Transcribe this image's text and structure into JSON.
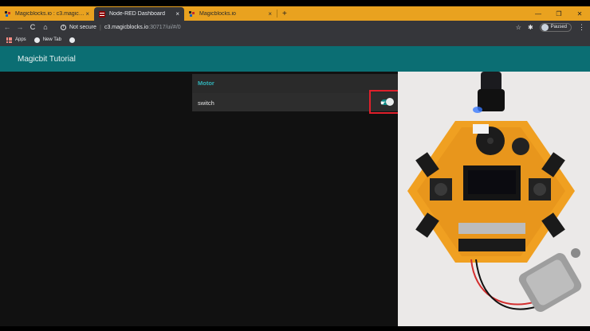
{
  "tabs": [
    {
      "label": "Magicblocks.io : c3.magicblocks...",
      "active": false,
      "favicon": "magicblocks-favicon"
    },
    {
      "label": "Node-RED Dashboard",
      "active": true,
      "favicon": "node-red-favicon"
    },
    {
      "label": "Magicblocks.io",
      "active": false,
      "favicon": "magicblocks-favicon"
    }
  ],
  "tab_close_glyph": "×",
  "new_tab_glyph": "+",
  "window_controls": {
    "minimize": "—",
    "restore": "❐",
    "close": "✕"
  },
  "toolbar": {
    "back": "←",
    "forward": "→",
    "reload": "C",
    "home": "⌂",
    "security_label": "Not secure",
    "url_host": "c3.magicblocks.io",
    "url_path": ":30717/ui/#/0",
    "star": "☆",
    "extensions": "✱",
    "profile_label": "Paused",
    "menu": "⋮"
  },
  "bookmarks": [
    {
      "label": "Apps",
      "icon": "apps-grid-icon"
    },
    {
      "label": "New Tab",
      "icon": "globe-icon"
    },
    {
      "label": "",
      "icon": "globe-icon"
    }
  ],
  "dashboard": {
    "title": "Magicbit Tutorial",
    "group_title": "Motor",
    "switch_label": "switch",
    "switch_on": true
  },
  "colors": {
    "tab_strip": "#e9a21f",
    "header": "#0b6e73",
    "group_title": "#31b2b8",
    "toggle_on": "#0e8a86",
    "highlight": "#e0202b"
  }
}
